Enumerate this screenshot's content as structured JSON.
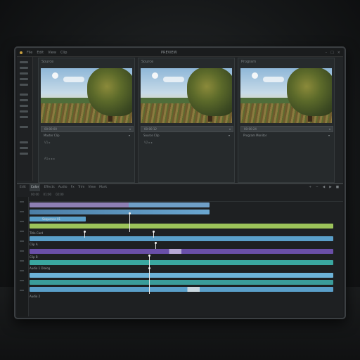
{
  "app": {
    "title": "PREVIEW",
    "menu": [
      "File",
      "Edit",
      "View",
      "Clip"
    ],
    "window_controls": [
      "–",
      "□",
      "×"
    ]
  },
  "viewers": [
    {
      "header": "Source",
      "bar_label": "00:00:00",
      "sub_label": "Master Clip",
      "rows": [
        "V1 ▸",
        "A1 ▸ ▸ ▸"
      ]
    },
    {
      "header": "Source",
      "bar_label": "00:00:12",
      "sub_label": "Source Clip",
      "rows": [
        "V2 ▸ ▸"
      ]
    },
    {
      "header": "Program",
      "bar_label": "00:00:24",
      "sub_label": "Program Monitor",
      "rows": []
    }
  ],
  "timeline": {
    "toolbar": [
      "Edit",
      "Color",
      "Effects",
      "Audio",
      "Fx",
      "Trim",
      "View",
      "Mark"
    ],
    "active_tool": "Color",
    "right_tools": [
      "+",
      "−",
      "◀",
      "▶",
      "■"
    ],
    "sub": [
      "00:00",
      "01:00",
      "02:00"
    ],
    "track_labels": [
      "Sequence 01",
      "Title Card",
      "Clip A",
      "Clip B",
      "Audio 1 Dialog",
      "Audio 2"
    ]
  },
  "colors": {
    "purple": "#8d7fb4",
    "blue": "#5a9fc9",
    "green": "#9cc35a",
    "violet": "#6a4fa8",
    "teal": "#3aa7a0",
    "light_blue": "#6db3d8"
  }
}
